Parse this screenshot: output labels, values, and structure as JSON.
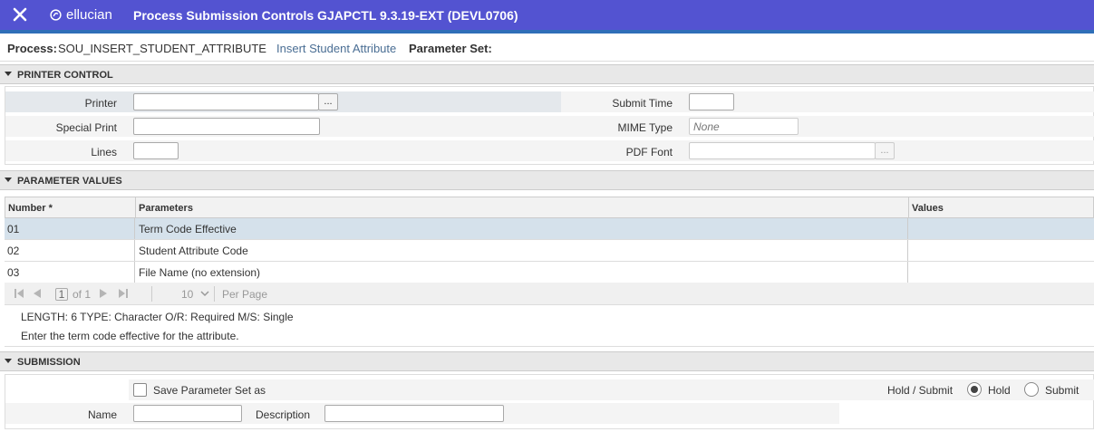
{
  "topbar": {
    "brand": "ellucian",
    "title": "Process Submission Controls GJAPCTL 9.3.19-EXT (DEVL0706)"
  },
  "process": {
    "label": "Process:",
    "code": "SOU_INSERT_STUDENT_ATTRIBUTE",
    "description": "Insert Student Attribute",
    "parameter_set_label": "Parameter Set:"
  },
  "printer_control": {
    "header": "PRINTER CONTROL",
    "printer_label": "Printer",
    "printer_value": "",
    "special_print_label": "Special Print",
    "special_print_value": "",
    "lines_label": "Lines",
    "lines_value": "",
    "submit_time_label": "Submit Time",
    "submit_time_value": "",
    "mime_type_label": "MIME Type",
    "mime_type_placeholder": "None",
    "pdf_font_label": "PDF Font",
    "pdf_font_value": "",
    "lookup_label": "..."
  },
  "parameter_values": {
    "header": "PARAMETER VALUES",
    "columns": [
      "Number *",
      "Parameters",
      "Values"
    ],
    "rows": [
      {
        "number": "01",
        "parameter": "Term Code Effective",
        "value": "",
        "selected": true
      },
      {
        "number": "02",
        "parameter": "Student Attribute Code",
        "value": "",
        "selected": false
      },
      {
        "number": "03",
        "parameter": "File Name (no extension)",
        "value": "",
        "selected": false
      }
    ],
    "pager": {
      "current_page": "1",
      "of_label": "of 1",
      "per_page": "10",
      "per_page_label": "Per Page"
    },
    "info_line1": "LENGTH: 6 TYPE: Character O/R: Required M/S: Single",
    "info_line2": "Enter the term code effective for the attribute."
  },
  "submission": {
    "header": "SUBMISSION",
    "save_label": "Save Parameter Set as",
    "name_label": "Name",
    "name_value": "",
    "description_label": "Description",
    "description_value": "",
    "hold_submit_label": "Hold / Submit",
    "hold_label": "Hold",
    "submit_label": "Submit",
    "selected": "Hold"
  },
  "colors": {
    "topbar": "#5353d1",
    "selected_row": "#d5e1eb",
    "link_text": "#4a6e94"
  }
}
